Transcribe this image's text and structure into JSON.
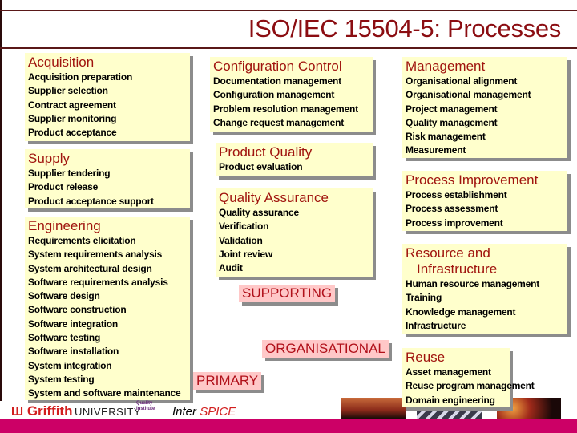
{
  "title": "ISO/IEC 15504-5: Processes",
  "primary": [
    {
      "heading": "Acquisition",
      "items": [
        "Acquisition preparation",
        "Supplier selection",
        "Contract agreement",
        "Supplier monitoring",
        "Product acceptance"
      ]
    },
    {
      "heading": "Supply",
      "items": [
        "Supplier tendering",
        "Product release",
        "Product acceptance support"
      ]
    },
    {
      "heading": "Engineering",
      "items": [
        "Requirements elicitation",
        "System requirements analysis",
        "System architectural design",
        "Software requirements analysis",
        "Software design",
        "Software construction",
        "Software integration",
        "Software testing",
        "Software installation",
        "System integration",
        "System testing",
        "System and software maintenance"
      ]
    }
  ],
  "supporting": [
    {
      "heading": "Configuration Control",
      "items": [
        "Documentation management",
        "Configuration management",
        "Problem resolution management",
        "Change request management"
      ]
    },
    {
      "heading": "Product Quality",
      "items": [
        "Product evaluation"
      ]
    },
    {
      "heading": "Quality Assurance",
      "items": [
        "Quality assurance",
        "Verification",
        "Validation",
        "Joint review",
        "Audit"
      ]
    }
  ],
  "organisational": [
    {
      "heading": "Management",
      "items": [
        "Organisational alignment",
        "Organisational management",
        "Project management",
        "Quality management",
        "Risk management",
        "Measurement"
      ]
    },
    {
      "heading": "Process Improvement",
      "items": [
        "Process establishment",
        "Process assessment",
        "Process improvement"
      ]
    },
    {
      "heading": "Resource and   Infrastructure",
      "heading_line1": "Resource and",
      "heading_line2": "Infrastructure",
      "items": [
        "Human resource management",
        "Training",
        "Knowledge management",
        "Infrastructure"
      ]
    },
    {
      "heading": "Reuse",
      "items": [
        "Asset management",
        "Reuse program management",
        "Domain engineering"
      ]
    }
  ],
  "categories": {
    "supporting": "SUPPORTING",
    "organisational": "ORGANISATIONAL",
    "primary": "PRIMARY"
  },
  "footer": {
    "logo_name": "Griffith",
    "logo_suffix": "UNIVERSITY",
    "qi_line1": "Quality",
    "qi_line2": "Institute",
    "inter": "Inter",
    "spice": "SPICE"
  },
  "colors": {
    "heading": "#a0140e",
    "title": "#8b0d12",
    "box_bg": "#ffffcc",
    "category_bg": "#ffc8c8",
    "footer_bar": "#cc0066"
  }
}
